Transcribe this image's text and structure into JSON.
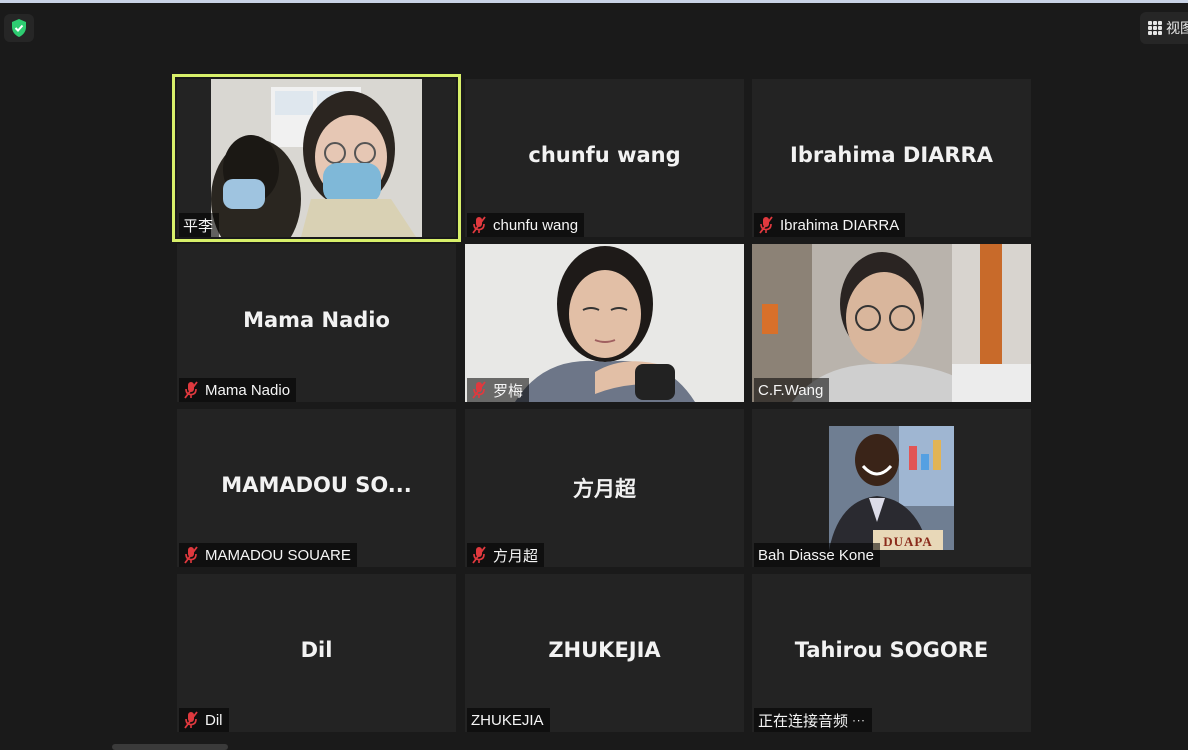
{
  "toolbar": {
    "view_label": "视图"
  },
  "participants": [
    {
      "name": "平李",
      "label": "平李",
      "muted": false,
      "video": true
    },
    {
      "name": "chunfu wang",
      "label": "chunfu wang",
      "muted": true,
      "video": false
    },
    {
      "name": "Ibrahima DIARRA",
      "label": "Ibrahima DIARRA",
      "muted": true,
      "video": false
    },
    {
      "name": "Mama Nadio",
      "label": "Mama Nadio",
      "muted": true,
      "video": false
    },
    {
      "name": "罗梅",
      "label": "罗梅",
      "muted": true,
      "video": true
    },
    {
      "name": "C.F.Wang",
      "label": "C.F.Wang",
      "muted": false,
      "video": true
    },
    {
      "name": "MAMADOU SO...",
      "label": "MAMADOU SOUARE",
      "muted": true,
      "video": false
    },
    {
      "name": "方月超",
      "label": "方月超",
      "muted": true,
      "video": false
    },
    {
      "name": "Bah Diasse Kone",
      "label": "Bah Diasse Kone",
      "muted": false,
      "video": true,
      "sign_text": "DUAPA"
    },
    {
      "name": "Dil",
      "label": "Dil",
      "muted": true,
      "video": false
    },
    {
      "name": "ZHUKEJIA",
      "label": "ZHUKEJIA",
      "muted": false,
      "video": false
    },
    {
      "name": "Tahirou SOGORE",
      "label": "正在连接音频",
      "muted": false,
      "video": false,
      "connecting": true
    }
  ],
  "colors": {
    "active_speaker": "#d8f06a",
    "muted_icon": "#e0393e",
    "shield": "#2ecc71"
  }
}
